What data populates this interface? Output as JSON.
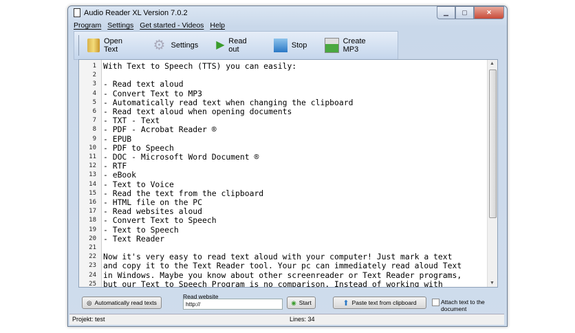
{
  "window": {
    "title": "Audio Reader XL Version 7.0.2"
  },
  "menu": [
    "Program",
    "Settings",
    "Get started - Videos",
    "Help"
  ],
  "toolbar": [
    {
      "label": "Open Text",
      "icon": "books-icon"
    },
    {
      "label": "Settings",
      "icon": "gear-icon"
    },
    {
      "label": "Read out",
      "icon": "play-icon"
    },
    {
      "label": "Stop",
      "icon": "stop-icon"
    },
    {
      "label": "Create MP3",
      "icon": "mp3-icon"
    }
  ],
  "editor": {
    "lines": [
      "With Text to Speech (TTS) you can easily:",
      "",
      "- Read text aloud",
      "- Convert Text to MP3",
      "- Automatically read text when changing the clipboard",
      "- Read text aloud when opening documents",
      "- TXT - Text",
      "- PDF - Acrobat Reader ®",
      "- EPUB",
      "- PDF to Speech",
      "- DOC - Microsoft Word Document ®",
      "- RTF",
      "- eBook",
      "- Text to Voice",
      "- Read the text from the clipboard",
      "- HTML file on the PC",
      "- Read websites aloud",
      "- Convert Text to Speech",
      "- Text to Speech",
      "- Text Reader",
      "",
      "Now it's very easy to read text aloud with your computer! Just mark a text",
      "and copy it to the Text Reader tool. Your pc can immediately read aloud Text",
      "in Windows. Maybe you know about other screenreader or Text Reader programs,",
      "but our Text to Speech Program is no comparison. Instead of working with"
    ]
  },
  "bottom": {
    "auto_read": "Automatically read texts",
    "website_label": "Read website",
    "website_value": "http://",
    "start": "Start",
    "paste": "Paste text from clipboard",
    "attach": "Attach text to the document"
  },
  "status": {
    "project": "Projekt: test",
    "lines": "Lines: 34"
  }
}
